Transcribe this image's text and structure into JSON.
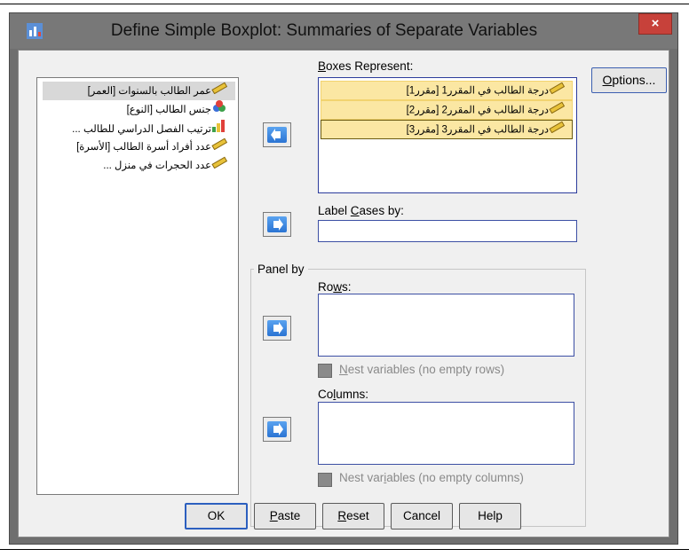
{
  "window": {
    "title": "Define Simple Boxplot: Summaries of Separate Variables",
    "close_label": "×"
  },
  "variables": [
    {
      "label": "عمر الطالب بالسنوات [العمر]",
      "icon": "ruler-scale-icon",
      "selected": true
    },
    {
      "label": "جنس الطالب [النوع]",
      "icon": "nominal-circles-icon",
      "selected": false
    },
    {
      "label": "ترتيب الفصل الدراسي للطالب ...",
      "icon": "ordinal-bars-icon",
      "selected": false
    },
    {
      "label": "عدد أفراد أسرة الطالب [الأسرة]",
      "icon": "ruler-scale-icon",
      "selected": false
    },
    {
      "label": "عدد الحجرات في منزل ...",
      "icon": "ruler-scale-icon",
      "selected": false
    }
  ],
  "boxes": {
    "label_prefix": "",
    "label_mnemonic": "B",
    "label_rest": "oxes Represent:",
    "items": [
      {
        "label": "درجة الطالب في المقرر1 [مقرر1]",
        "icon": "ruler-scale-icon"
      },
      {
        "label": "درجة الطالب في المقرر2 [مقرر2]",
        "icon": "ruler-scale-icon"
      },
      {
        "label": "درجة الطالب في المقرر3 [مقرر3]",
        "icon": "ruler-scale-icon"
      }
    ]
  },
  "label_cases": {
    "prefix": "Label ",
    "mnemonic": "C",
    "rest": "ases by:",
    "value": ""
  },
  "panel": {
    "title": "Panel by",
    "rows": {
      "prefix": "Ro",
      "mnemonic": "w",
      "rest": "s:"
    },
    "rows_nest": {
      "prefix": "",
      "mnemonic": "N",
      "rest": "est variables (no empty rows)"
    },
    "columns": {
      "prefix": "Co",
      "mnemonic": "l",
      "rest": "umns:"
    },
    "columns_nest": {
      "prefix": "Nest var",
      "mnemonic": "i",
      "rest": "ables (no empty columns)"
    }
  },
  "buttons": {
    "options": {
      "prefix": "",
      "mnemonic": "O",
      "rest": "ptions..."
    },
    "ok": "OK",
    "paste": {
      "mnemonic": "P",
      "rest": "aste"
    },
    "reset": {
      "mnemonic": "R",
      "rest": "eset"
    },
    "cancel": "Cancel",
    "help": "Help"
  },
  "colors": {
    "selection_fill": "#fbe7a3",
    "arrow_blue": "#2b74d3",
    "close_red": "#c7413a"
  }
}
